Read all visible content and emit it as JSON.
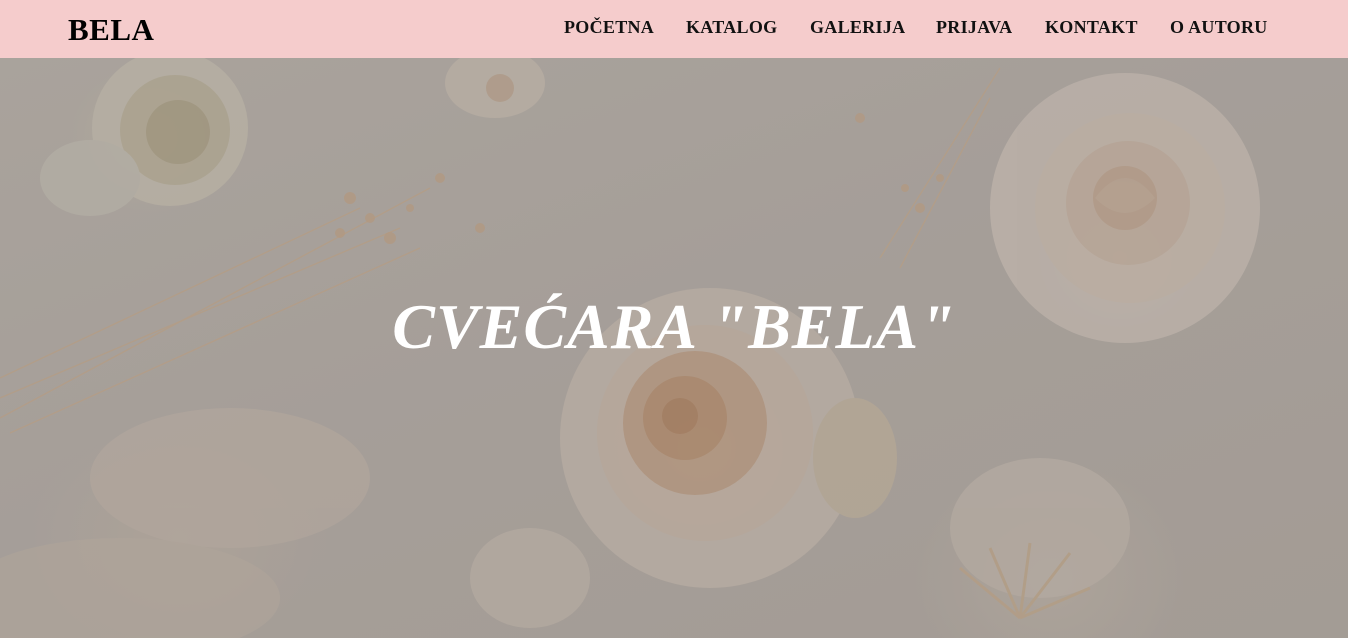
{
  "navbar": {
    "brand": "BELA",
    "items": [
      {
        "label": "POČETNA"
      },
      {
        "label": "KATALOG"
      },
      {
        "label": "GALERIJA"
      },
      {
        "label": "PRIJAVA"
      },
      {
        "label": "KONTAKT"
      },
      {
        "label": "O AUTORU"
      }
    ],
    "background_color": "#f5cccc"
  },
  "hero": {
    "title": "CVEĆARA \"BELA\"",
    "background_image": "flower-arrangement-photo"
  }
}
